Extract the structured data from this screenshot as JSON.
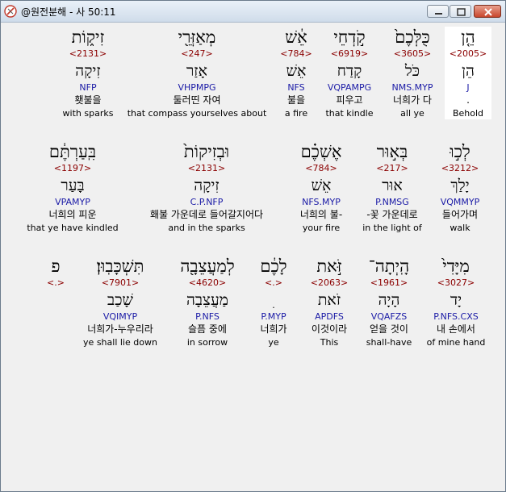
{
  "window": {
    "title": "@원전분해 - 사 50:11"
  },
  "rows": [
    [
      {
        "heb": "הֵ֤ן",
        "strong": "<2005>",
        "lemma": "הֵן",
        "parse": "J",
        "kor": ".",
        "eng": "Behold",
        "selected": true
      },
      {
        "heb": "כֻּלְּכֶם֙",
        "strong": "<3605>",
        "lemma": "כֹּל",
        "parse": "NMS.MYP",
        "kor": "너희가 다",
        "eng": "all ye"
      },
      {
        "heb": "קֹ֣דְחֵי",
        "strong": "<6919>",
        "lemma": "קָדַח",
        "parse": "VQPAMPG",
        "kor": "피우고",
        "eng": "that kindle"
      },
      {
        "heb": "אֵ֔שׁ",
        "strong": "<784>",
        "lemma": "אֵשׁ",
        "parse": "NFS",
        "kor": "불을",
        "eng": "a fire"
      },
      {
        "heb": "מְאַזְּרֵ֖י",
        "strong": "<247>",
        "lemma": "אָזַר",
        "parse": "VHPMPG",
        "kor": "둘러띤 자여",
        "eng": "that compass yourselves about"
      },
      {
        "heb": "זִיק֑וֹת",
        "strong": "<2131>",
        "lemma": "זִיקָה",
        "parse": "NFP",
        "kor": "횃불을",
        "eng": "with sparks"
      }
    ],
    [
      {
        "heb": "לְכ֣וּ",
        "strong": "<3212>",
        "lemma": "יָלַךְ",
        "parse": "VQMMYP",
        "kor": "들어가며",
        "eng": "walk"
      },
      {
        "heb": "בְּא֣וּר",
        "strong": "<217>",
        "lemma": "אוּר",
        "parse": "P.NMSG",
        "kor": "-꽃 가운데로",
        "eng": "in the light of"
      },
      {
        "heb": "אֶשְׁכֶ֗ם",
        "strong": "<784>",
        "lemma": "אֵשׁ",
        "parse": "NFS.MYP",
        "kor": "너희의 불-",
        "eng": "your fire"
      },
      {
        "heb": "וּבְזִיקוֹת֙",
        "strong": "<2131>",
        "lemma": "C.P.NFP",
        "lemmaHeb": "זִיקָה",
        "parse": "C.P.NFP",
        "kor": "홰불 가운데로 들어갈지어다",
        "eng": "and in the sparks"
      },
      {
        "heb": "בִּֽעַרְתֶּ֔ם",
        "strong": "<1197>",
        "lemma": "בָּעַר",
        "parse": "VPAMYP",
        "kor": "너희의 피운",
        "eng": "that ye have kindled"
      }
    ],
    [
      {
        "heb": "מִיָּדִי֙",
        "strong": "<3027>",
        "lemma": "יָד",
        "parse": "P.NFS.CXS",
        "kor": "내 손에서",
        "eng": "of mine hand"
      },
      {
        "heb": "הָֽיְתָה־",
        "strong": "<1961>",
        "lemma": "הָיָה",
        "parse": "VQAFZS",
        "kor": "얻을 것이",
        "eng": "shall-have"
      },
      {
        "heb": "זֹּ֣את",
        "strong": "<2063>",
        "lemma": "זֹאת",
        "parse": "APDFS",
        "kor": "이것이라",
        "eng": "This"
      },
      {
        "heb": "לָכֶ֔ם",
        "strong": "<.>",
        "lemma": "ׅ",
        "parse": "P.MYP",
        "kor": "너희가",
        "eng": "ye"
      },
      {
        "heb": "לְמַעֲצֵבָ֖ה",
        "strong": "<4620>",
        "lemma": "מַעֲצֵבָה",
        "parse": "P.NFS",
        "kor": "슬픔 중에",
        "eng": "in sorrow"
      },
      {
        "heb": "תִּשְׁכָּבֽוּן׃",
        "strong": "<7901>",
        "lemma": "שָׁכַב",
        "parse": "VQIMYP",
        "kor": "너희가-누우리라",
        "eng": "ye shall lie down"
      },
      {
        "heb": "פ",
        "strong": "<.>",
        "lemma": "",
        "parse": "",
        "kor": "",
        "eng": ""
      }
    ]
  ]
}
